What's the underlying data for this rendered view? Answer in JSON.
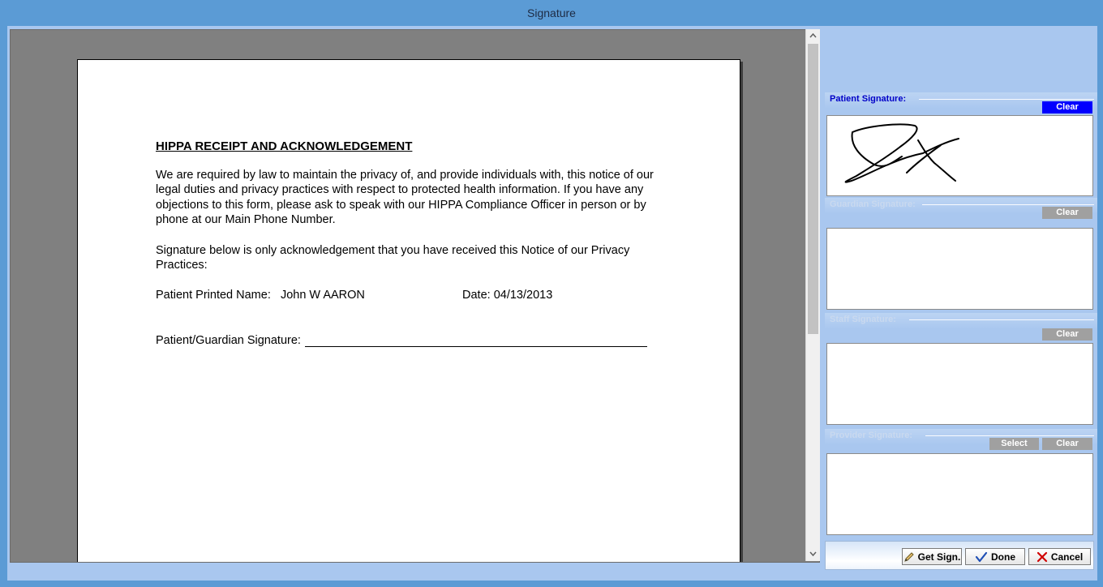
{
  "window": {
    "title": "Signature"
  },
  "document": {
    "title": "HIPPA RECEIPT AND ACKNOWLEDGEMENT",
    "paragraph1": "We are required by law to maintain the privacy of, and provide individuals with, this notice of our legal duties and privacy practices with respect to protected health information.  If you have any objections to this form, please ask to speak with our HIPPA Compliance Officer in person or by phone at our Main Phone Number.",
    "paragraph2": "Signature below is only acknowledgement that you have received this Notice of our Privacy Practices:",
    "printed_name_label": "Patient Printed Name:",
    "printed_name_value": "John W AARON",
    "date_label": "Date:",
    "date_value": "04/13/2013",
    "signature_label": "Patient/Guardian Signature:"
  },
  "signatures": {
    "patient": {
      "label": "Patient Signature:",
      "clear": "Clear"
    },
    "guardian": {
      "label": "Guardian Signature:",
      "clear": "Clear"
    },
    "staff": {
      "label": "Staff Signature:",
      "clear": "Clear"
    },
    "provider": {
      "label": "Provider Signature:",
      "select": "Select",
      "clear": "Clear"
    }
  },
  "actions": {
    "get_sign": "Get Sign.",
    "done": "Done",
    "cancel": "Cancel"
  },
  "icons": {
    "scroll_up": "chevron-up-icon",
    "scroll_down": "chevron-down-icon",
    "get_sign": "pen-icon",
    "done": "check-icon",
    "cancel": "close-icon"
  },
  "colors": {
    "title_bar": "#5b9bd5",
    "panel_bg": "#a9c7ef",
    "active_clear": "#0000ff",
    "inactive_button": "#a0a0a0",
    "active_label": "#0000c8"
  }
}
